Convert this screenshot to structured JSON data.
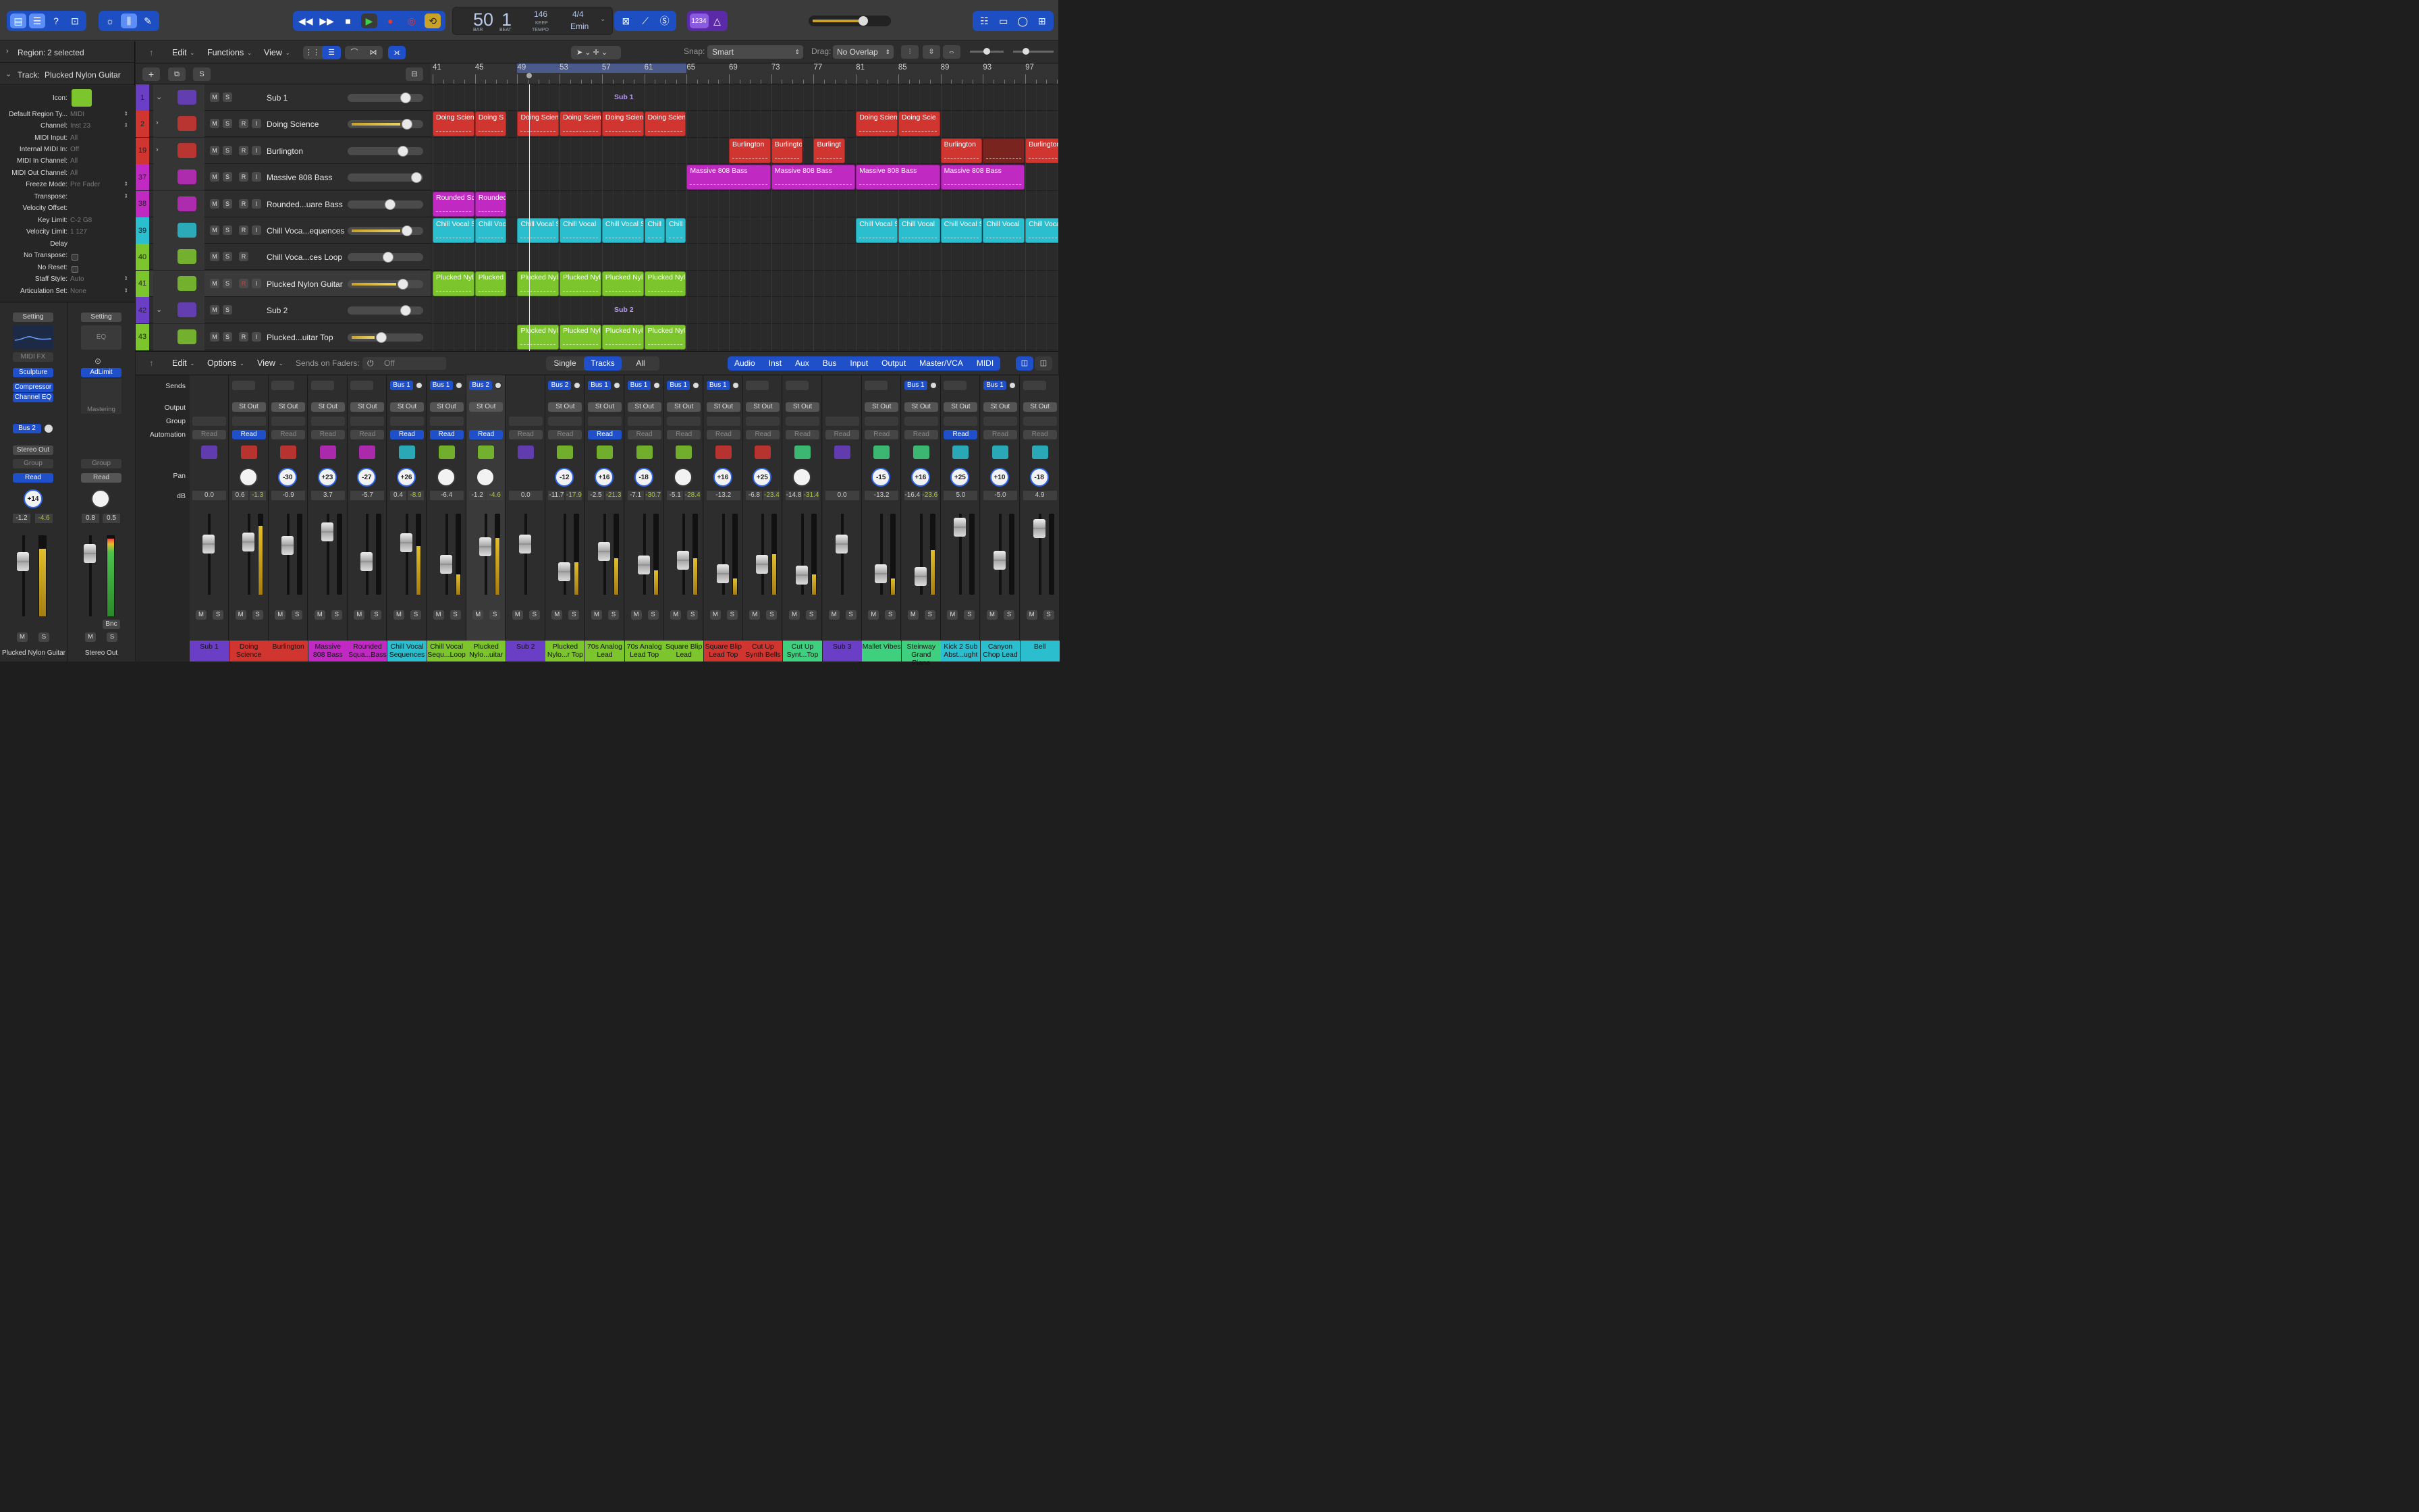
{
  "lcd": {
    "bar": "50",
    "beat": "1",
    "bar_label": "BAR",
    "beat_label": "BEAT",
    "tempo": "146",
    "tempo_sub": "KEEP",
    "tempo_label": "TEMPO",
    "sig": "4/4",
    "key": "Emin"
  },
  "display_button": "1234",
  "inspector": {
    "region_label": "Region:",
    "region_value": "2 selected",
    "track_label": "Track:",
    "track_value": "Plucked Nylon Guitar",
    "icon_label": "Icon:",
    "rows": [
      {
        "label": "Default Region Ty...",
        "value": "MIDI"
      },
      {
        "label": "Channel:",
        "value": "Inst 23"
      },
      {
        "label": "MIDI Input:",
        "value": "All"
      },
      {
        "label": "Internal MIDI In:",
        "value": "Off"
      },
      {
        "label": "MIDI In Channel:",
        "value": "All"
      },
      {
        "label": "MIDI Out Channel:",
        "value": "All"
      },
      {
        "label": "Freeze Mode:",
        "value": "Pre Fader"
      },
      {
        "label": "Transpose:",
        "value": ""
      },
      {
        "label": "Velocity Offset:",
        "value": ""
      },
      {
        "label": "Key Limit:",
        "value": "C-2  G8"
      },
      {
        "label": "Velocity Limit:",
        "value": "1  127"
      },
      {
        "label": "Delay",
        "value": ""
      },
      {
        "label": "No Transpose:",
        "value": ""
      },
      {
        "label": "No Reset:",
        "value": ""
      },
      {
        "label": "Staff Style:",
        "value": "Auto"
      },
      {
        "label": "Articulation Set:",
        "value": "None"
      }
    ],
    "strip1": {
      "setting": "Setting",
      "midifx": "MIDI FX",
      "plugins": [
        "Sculpture",
        "Compressor",
        "Channel EQ"
      ],
      "bus": "Bus 2",
      "output": "Stereo Out",
      "group": "Group",
      "read": "Read",
      "pan": "+14",
      "db1": "-1.2",
      "db2": "-4.6",
      "name": "Plucked Nylon Guitar"
    },
    "strip2": {
      "setting": "Setting",
      "eq": "EQ",
      "plugins": [
        "AdLimit"
      ],
      "mastering": "Mastering",
      "group": "Group",
      "read": "Read",
      "db1": "0.8",
      "db2": "0.5",
      "bnc": "Bnc",
      "name": "Stereo Out"
    }
  },
  "tracks_bar": {
    "edit": "Edit",
    "functions": "Functions",
    "view": "View",
    "snap_label": "Snap:",
    "snap_value": "Smart",
    "drag_label": "Drag:",
    "drag_value": "No Overlap"
  },
  "ruler": [
    "41",
    "45",
    "49",
    "53",
    "57",
    "61",
    "65",
    "69",
    "73",
    "77",
    "81",
    "85",
    "89",
    "93",
    "97"
  ],
  "tracks": [
    {
      "num": "1",
      "name": "Sub 1",
      "color": "#6a3fc6",
      "folder": true,
      "cols": "MS"
    },
    {
      "num": "2",
      "name": "Doing Science",
      "color": "#d03530",
      "cols": "MSRI"
    },
    {
      "num": "19",
      "name": "Burlington",
      "color": "#d03530",
      "cols": "MSRI"
    },
    {
      "num": "37",
      "name": "Massive 808 Bass",
      "color": "#c12ac2",
      "cols": "MSRI"
    },
    {
      "num": "38",
      "name": "Rounded...uare Bass",
      "color": "#c12ac2",
      "cols": "MSRI"
    },
    {
      "num": "39",
      "name": "Chill Voca...equences",
      "color": "#2bbecf",
      "cols": "MSRI"
    },
    {
      "num": "40",
      "name": "Chill Voca...ces Loop",
      "color": "#7cc52c",
      "cols": "MSR"
    },
    {
      "num": "41",
      "name": "Plucked Nylon Guitar",
      "color": "#7cc52c",
      "cols": "MSRI"
    },
    {
      "num": "42",
      "name": "Sub 2",
      "color": "#6a3fc6",
      "folder": true,
      "cols": "MS"
    },
    {
      "num": "43",
      "name": "Plucked...uitar Top",
      "color": "#7cc52c",
      "cols": "MSRI"
    }
  ],
  "folder_labels": [
    "Sub 1",
    "Sub 2"
  ],
  "regions": [
    {
      "row": 1,
      "text": "Doing Scien",
      "bar": 41,
      "len": 4
    },
    {
      "row": 1,
      "text": "Doing S",
      "bar": 45,
      "len": 3
    },
    {
      "row": 1,
      "text": "Doing Scien",
      "bar": 49,
      "len": 4
    },
    {
      "row": 1,
      "text": "Doing Scien",
      "bar": 53,
      "len": 4
    },
    {
      "row": 1,
      "text": "Doing Scien",
      "bar": 57,
      "len": 4
    },
    {
      "row": 1,
      "text": "Doing Scien",
      "bar": 61,
      "len": 4
    },
    {
      "row": 1,
      "text": "Doing Scien",
      "bar": 81,
      "len": 4
    },
    {
      "row": 1,
      "text": "Doing Scie",
      "bar": 85,
      "len": 4
    },
    {
      "row": 2,
      "text": "Burlington",
      "bar": 69,
      "len": 4
    },
    {
      "row": 2,
      "text": "Burlingto",
      "bar": 73,
      "len": 3
    },
    {
      "row": 2,
      "text": "Burlingt",
      "bar": 77,
      "len": 3
    },
    {
      "row": 2,
      "text": "Burlington",
      "bar": 89,
      "len": 4
    },
    {
      "row": 2,
      "text": "",
      "bar": 93,
      "len": 4,
      "dark": true
    },
    {
      "row": 2,
      "text": "Burlington",
      "bar": 97,
      "len": 4
    },
    {
      "row": 3,
      "text": "Massive 808 Bass",
      "bar": 65,
      "len": 8
    },
    {
      "row": 3,
      "text": "Massive 808 Bass",
      "bar": 73,
      "len": 8
    },
    {
      "row": 3,
      "text": "Massive 808 Bass",
      "bar": 81,
      "len": 8
    },
    {
      "row": 3,
      "text": "Massive 808 Bass",
      "bar": 89,
      "len": 8
    },
    {
      "row": 4,
      "text": "Rounded Sq",
      "bar": 41,
      "len": 4
    },
    {
      "row": 4,
      "text": "Rounded",
      "bar": 45,
      "len": 3
    },
    {
      "row": 5,
      "text": "Chill Vocal S",
      "bar": 41,
      "len": 4
    },
    {
      "row": 5,
      "text": "Chill Voc",
      "bar": 45,
      "len": 3
    },
    {
      "row": 5,
      "text": "Chill Vocal S",
      "bar": 49,
      "len": 4
    },
    {
      "row": 5,
      "text": "Chill Vocal",
      "bar": 53,
      "len": 4
    },
    {
      "row": 5,
      "text": "Chill Vocal S",
      "bar": 57,
      "len": 4
    },
    {
      "row": 5,
      "text": "Chill",
      "bar": 61,
      "len": 2
    },
    {
      "row": 5,
      "text": "Chill",
      "bar": 63,
      "len": 2
    },
    {
      "row": 5,
      "text": "Chill Vocal S",
      "bar": 81,
      "len": 4
    },
    {
      "row": 5,
      "text": "Chill Vocal",
      "bar": 85,
      "len": 4
    },
    {
      "row": 5,
      "text": "Chill Vocal S",
      "bar": 89,
      "len": 4
    },
    {
      "row": 5,
      "text": "Chill Vocal",
      "bar": 93,
      "len": 4
    },
    {
      "row": 5,
      "text": "Chill Vocal",
      "bar": 97,
      "len": 4
    },
    {
      "row": 7,
      "text": "Plucked Nyl",
      "bar": 41,
      "len": 4
    },
    {
      "row": 7,
      "text": "Plucked",
      "bar": 45,
      "len": 3
    },
    {
      "row": 7,
      "text": "Plucked Nyl",
      "bar": 49,
      "len": 4
    },
    {
      "row": 7,
      "text": "Plucked Nyl",
      "bar": 53,
      "len": 4
    },
    {
      "row": 7,
      "text": "Plucked Nyl",
      "bar": 57,
      "len": 4
    },
    {
      "row": 7,
      "text": "Plucked Nyl",
      "bar": 61,
      "len": 4
    },
    {
      "row": 9,
      "text": "Plucked Nyl",
      "bar": 49,
      "len": 4
    },
    {
      "row": 9,
      "text": "Plucked Nyl",
      "bar": 53,
      "len": 4
    },
    {
      "row": 9,
      "text": "Plucked Nyl",
      "bar": 57,
      "len": 4
    },
    {
      "row": 9,
      "text": "Plucked Nyl",
      "bar": 61,
      "len": 4
    }
  ],
  "mixer_bar": {
    "edit": "Edit",
    "options": "Options",
    "view": "View",
    "sends_label": "Sends on Faders:",
    "sends_value": "Off",
    "single": "Single",
    "tracks": "Tracks",
    "all": "All",
    "filters": [
      "Audio",
      "Inst",
      "Aux",
      "Bus",
      "Input",
      "Output",
      "Master/VCA",
      "MIDI"
    ]
  },
  "mixer_labels": [
    "Sends",
    "Output",
    "Group",
    "Automation",
    "Pan",
    "dB"
  ],
  "strips": [
    {
      "name": "Sub 1",
      "color": "#6a3fc6",
      "bus": "",
      "out": "",
      "read": "Read",
      "ron": false,
      "pan": "",
      "db": "0.0",
      "db2": "",
      "fader": 0.72,
      "meter": 0
    },
    {
      "name": "Doing Science",
      "color": "#d03530",
      "bus": "",
      "out": "St Out",
      "read": "Read",
      "ron": true,
      "pan": "",
      "db": "0.6",
      "db2": "-1.3",
      "fader": 0.75,
      "meter": 0.85
    },
    {
      "name": "Burlington",
      "color": "#d03530",
      "bus": "",
      "out": "St Out",
      "read": "Read",
      "ron": false,
      "pan": "-30",
      "db": "-0.9",
      "db2": "",
      "fader": 0.7,
      "meter": 0
    },
    {
      "name": "Massive 808 Bass",
      "color": "#c12ac2",
      "bus": "",
      "out": "St Out",
      "read": "Read",
      "ron": false,
      "pan": "+23",
      "db": "3.7",
      "db2": "",
      "fader": 0.88,
      "meter": 0
    },
    {
      "name": "Rounded Squa...Bass",
      "color": "#c12ac2",
      "bus": "",
      "out": "St Out",
      "read": "Read",
      "ron": false,
      "pan": "-27",
      "db": "-5.7",
      "db2": "",
      "fader": 0.48,
      "meter": 0
    },
    {
      "name": "Chill Vocal Sequences",
      "color": "#2bbecf",
      "bus": "Bus 1",
      "out": "St Out",
      "read": "Read",
      "ron": true,
      "pan": "+26",
      "db": "0.4",
      "db2": "-8.9",
      "fader": 0.74,
      "meter": 0.6
    },
    {
      "name": "Chill Vocal Sequ...Loop",
      "color": "#7cc52c",
      "bus": "Bus 1",
      "out": "St Out",
      "read": "Read",
      "ron": true,
      "pan": "",
      "db": "-6.4",
      "db2": "",
      "fader": 0.45,
      "meter": 0.25
    },
    {
      "name": "Plucked Nylo...uitar",
      "color": "#7cc52c",
      "bus": "Bus 2",
      "out": "St Out",
      "read": "Read",
      "ron": true,
      "pan": "",
      "db": "-1.2",
      "db2": "-4.6",
      "fader": 0.68,
      "meter": 0.7
    },
    {
      "name": "Sub 2",
      "color": "#6a3fc6",
      "bus": "",
      "out": "",
      "read": "Read",
      "ron": false,
      "pan": "",
      "db": "0.0",
      "db2": "",
      "fader": 0.72,
      "meter": 0
    },
    {
      "name": "Plucked Nylo...r Top",
      "color": "#7cc52c",
      "bus": "Bus 2",
      "out": "St Out",
      "read": "Read",
      "ron": false,
      "pan": "-12",
      "db": "-11.7",
      "db2": "-17.9",
      "fader": 0.35,
      "meter": 0.4
    },
    {
      "name": "70s Analog Lead",
      "color": "#7cc52c",
      "bus": "Bus 1",
      "out": "St Out",
      "read": "Read",
      "ron": true,
      "pan": "+16",
      "db": "-2.5",
      "db2": "-21.3",
      "fader": 0.62,
      "meter": 0.45
    },
    {
      "name": "70s Analog Lead Top",
      "color": "#7cc52c",
      "bus": "Bus 1",
      "out": "St Out",
      "read": "Read",
      "ron": false,
      "pan": "-18",
      "db": "-7.1",
      "db2": "-30.7",
      "fader": 0.44,
      "meter": 0.3
    },
    {
      "name": "Square Blip Lead",
      "color": "#7cc52c",
      "bus": "Bus 1",
      "out": "St Out",
      "read": "Read",
      "ron": false,
      "pan": "",
      "db": "-5.1",
      "db2": "-28.4",
      "fader": 0.5,
      "meter": 0.45
    },
    {
      "name": "Square Blip Lead Top",
      "color": "#d03530",
      "bus": "Bus 1",
      "out": "St Out",
      "read": "Read",
      "ron": false,
      "pan": "+16",
      "db": "-13.2",
      "db2": "",
      "fader": 0.32,
      "meter": 0.2
    },
    {
      "name": "Cut Up Synth Bells",
      "color": "#d03530",
      "bus": "",
      "out": "St Out",
      "read": "Read",
      "ron": false,
      "pan": "+25",
      "db": "-6.8",
      "db2": "-23.4",
      "fader": 0.45,
      "meter": 0.5
    },
    {
      "name": "Cut Up Synt...Top",
      "color": "#3fd07f",
      "bus": "",
      "out": "St Out",
      "read": "Read",
      "ron": false,
      "pan": "",
      "db": "-14.8",
      "db2": "-31.4",
      "fader": 0.3,
      "meter": 0.25
    },
    {
      "name": "Sub 3",
      "color": "#6a3fc6",
      "bus": "",
      "out": "",
      "read": "Read",
      "ron": false,
      "pan": "",
      "db": "0.0",
      "db2": "",
      "fader": 0.72,
      "meter": 0
    },
    {
      "name": "Mallet Vibes",
      "color": "#3fd07f",
      "bus": "",
      "out": "St Out",
      "read": "Read",
      "ron": false,
      "pan": "-15",
      "db": "-13.2",
      "db2": "",
      "fader": 0.32,
      "meter": 0.2
    },
    {
      "name": "Steinway Grand Piano",
      "color": "#3fd07f",
      "bus": "Bus 1",
      "out": "St Out",
      "read": "Read",
      "ron": false,
      "pan": "+16",
      "db": "-16.4",
      "db2": "-23.6",
      "fader": 0.28,
      "meter": 0.55
    },
    {
      "name": "Kick 2 Sub Abst...ught",
      "color": "#2bbecf",
      "bus": "",
      "out": "St Out",
      "read": "Read",
      "ron": true,
      "pan": "+25",
      "db": "5.0",
      "db2": "",
      "fader": 0.95,
      "meter": 0
    },
    {
      "name": "Canyon Chop Lead",
      "color": "#2bbecf",
      "bus": "Bus 1",
      "out": "St Out",
      "read": "Read",
      "ron": false,
      "pan": "+10",
      "db": "-5.0",
      "db2": "",
      "fader": 0.5,
      "meter": 0
    },
    {
      "name": "Bell",
      "color": "#2bbecf",
      "bus": "",
      "out": "St Out",
      "read": "Read",
      "ron": false,
      "pan": "-18",
      "db": "4.9",
      "db2": "",
      "fader": 0.93,
      "meter": 0
    }
  ]
}
